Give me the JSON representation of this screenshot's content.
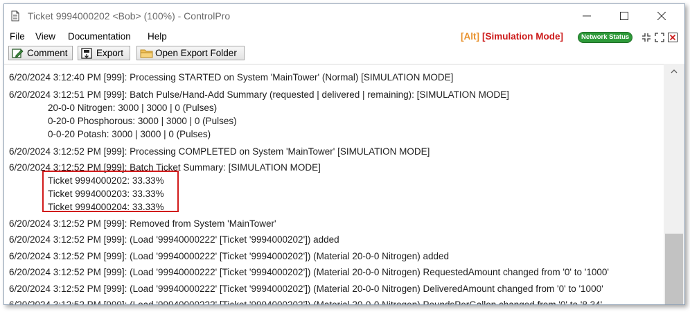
{
  "window": {
    "title": "Ticket 9994000202 <Bob> (100%) - ControlPro",
    "minimize_label": "",
    "maximize_label": "",
    "close_label": ""
  },
  "menu": {
    "items": [
      {
        "label": "File"
      },
      {
        "label": "View"
      },
      {
        "label": "Documentation"
      },
      {
        "label": "Help"
      }
    ],
    "alt_label": "[Alt]",
    "simulation_label": "[Simulation Mode]",
    "network_status_label": "Network Status"
  },
  "toolbar": {
    "comment_label": "Comment",
    "export_label": "Export",
    "open_folder_label": "Open Export Folder"
  },
  "log": {
    "lines": [
      "6/20/2024 3:12:40 PM [999]: Processing STARTED on System 'MainTower' (Normal) [SIMULATION MODE]",
      "6/20/2024 3:12:51 PM [999]: Batch Pulse/Hand-Add Summary (requested | delivered | remaining): [SIMULATION MODE]",
      "20-0-0 Nitrogen: 3000 | 3000 | 0 (Pulses)",
      "0-20-0 Phosphorous: 3000 | 3000 | 0 (Pulses)",
      "0-0-20 Potash: 3000 | 3000 | 0 (Pulses)",
      "6/20/2024 3:12:52 PM [999]: Processing COMPLETED on System 'MainTower' [SIMULATION MODE]",
      "6/20/2024 3:12:52 PM [999]: Batch Ticket Summary: [SIMULATION MODE]",
      "Ticket 9994000202: 33.33%",
      "Ticket 9994000203: 33.33%",
      "Ticket 9994000204: 33.33%",
      "6/20/2024 3:12:52 PM [999]: Removed from System 'MainTower'",
      "6/20/2024 3:12:52 PM [999]: (Load '99940000222' [Ticket '9994000202']) added",
      "6/20/2024 3:12:52 PM [999]: (Load '99940000222' [Ticket '9994000202']) (Material 20-0-0 Nitrogen) added",
      "6/20/2024 3:12:52 PM [999]: (Load '99940000222' [Ticket '9994000202']) (Material 20-0-0 Nitrogen) RequestedAmount changed from '0' to '1000'",
      "6/20/2024 3:12:52 PM [999]: (Load '99940000222' [Ticket '9994000202']) (Material 20-0-0 Nitrogen) DeliveredAmount changed from '0' to '1000'",
      "6/20/2024 3:12:52 PM [999]: (Load '99940000222' [Ticket '9994000202']) (Material 20-0-0 Nitrogen) PoundsPerGallon changed from '0' to '8.34'"
    ]
  },
  "colors": {
    "alt": "#e8902a",
    "simulation": "#cc1a1a",
    "network_status": "#2e9a3a",
    "highlight_box": "#d11b1b"
  },
  "icons": {
    "app": "document-icon",
    "comment": "comment-edit-icon",
    "export": "export-icon",
    "folder": "folder-icon",
    "collapse": "collapse-icon",
    "expand": "expand-icon",
    "close_doc": "close-document-icon"
  }
}
